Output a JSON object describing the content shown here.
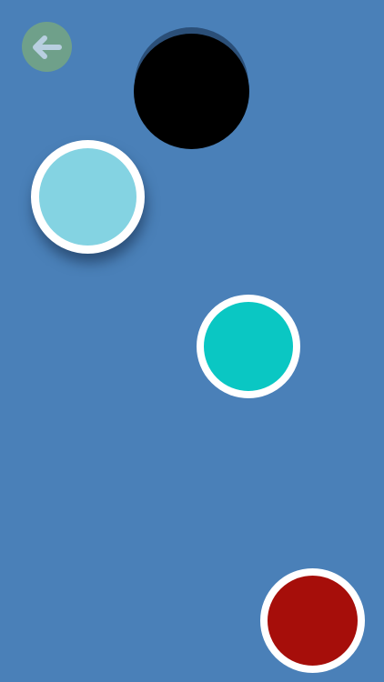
{
  "screen": {
    "background_color": "#4a80b8"
  },
  "back_button": {
    "icon": "arrow-left-icon",
    "background_color": "#6fa08a",
    "arrow_color": "#b8cfe0"
  },
  "hole": {
    "color": "#000000",
    "shadow_color": "#2b4f78"
  },
  "balls": [
    {
      "name": "ball-light-blue",
      "fill": "#84d3e2",
      "ring": "#ffffff"
    },
    {
      "name": "ball-teal",
      "fill": "#0ac7c3",
      "ring": "#ffffff"
    },
    {
      "name": "ball-red",
      "fill": "#a60e0a",
      "ring": "#ffffff"
    }
  ]
}
